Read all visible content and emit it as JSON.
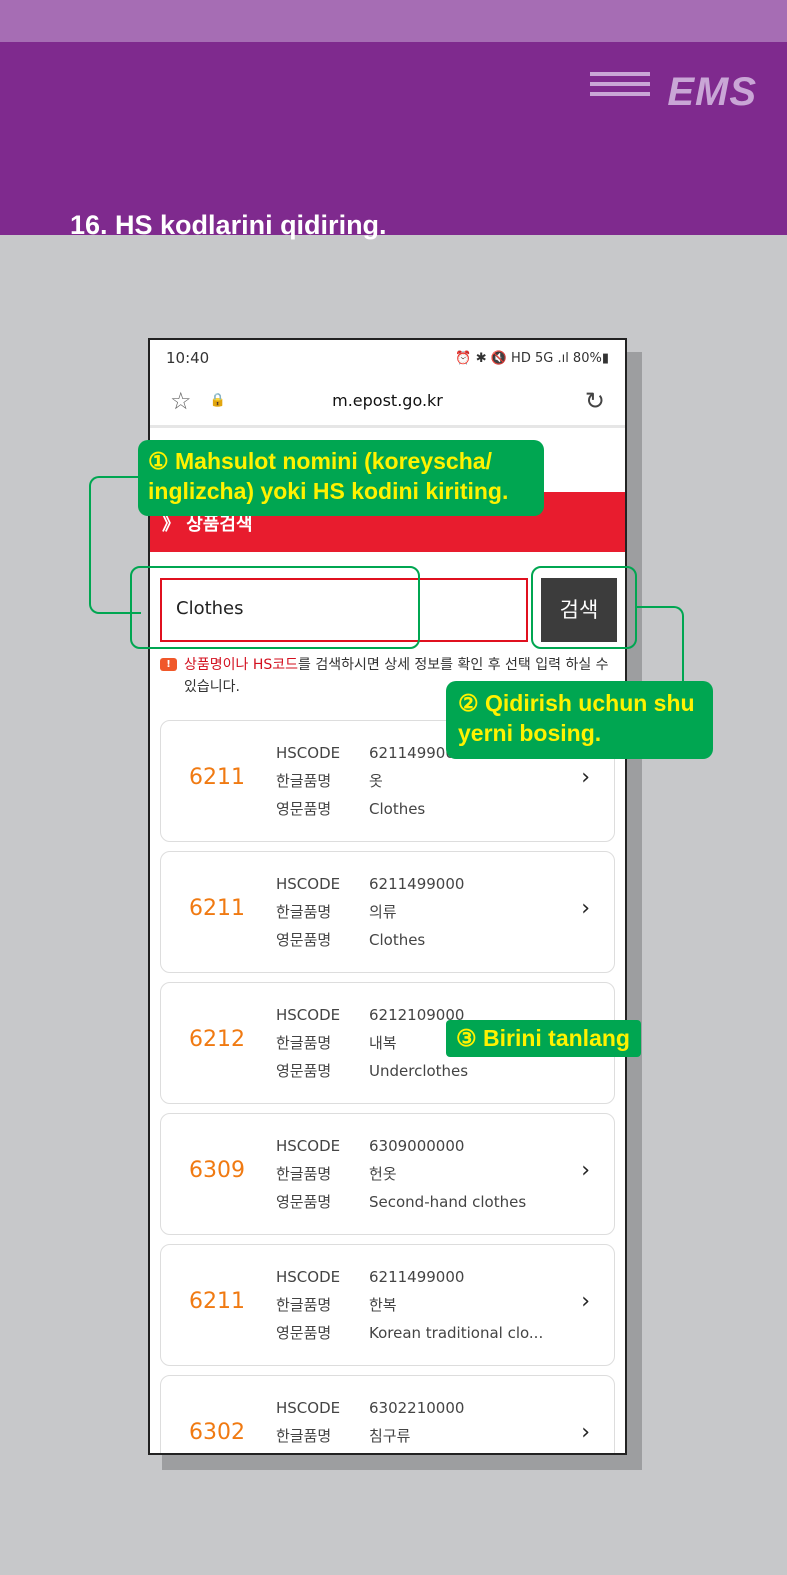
{
  "header": {
    "title": "16. HS kodlarini qidiring.",
    "logo": "EMS"
  },
  "phone": {
    "status": {
      "time": "10:40",
      "right": "⏰ ✱ 🔇 HD 5G .ıl 80%▮"
    },
    "browser": {
      "url": "m.epost.go.kr",
      "favorite_icon": "star-icon",
      "lock_icon": "lock-icon",
      "reload_icon": "reload-icon"
    },
    "section_title": "》 상품검색",
    "search": {
      "value": "Clothes",
      "button": "검색"
    },
    "notice": {
      "highlight": "상품명이나 HS코드",
      "text": "를 검색하시면 상세 정보를 확인 후 선택 입력 하실 수 있습니다."
    },
    "labels": {
      "hscode": "HSCODE",
      "korean": "한글품명",
      "english": "영문품명"
    },
    "results": [
      {
        "code": "6211",
        "hscode": "6211499000",
        "korean": "옷",
        "english": "Clothes"
      },
      {
        "code": "6211",
        "hscode": "6211499000",
        "korean": "의류",
        "english": "Clothes"
      },
      {
        "code": "6212",
        "hscode": "6212109000",
        "korean": "내복",
        "english": "Underclothes"
      },
      {
        "code": "6309",
        "hscode": "6309000000",
        "korean": "헌옷",
        "english": "Second-hand clothes"
      },
      {
        "code": "6211",
        "hscode": "6211499000",
        "korean": "한복",
        "english": "Korean traditional clo..."
      },
      {
        "code": "6302",
        "hscode": "6302210000",
        "korean": "침구류",
        "english": ""
      }
    ]
  },
  "annotations": {
    "a1": "① Mahsulot nomini (koreyscha/ inglizcha) yoki HS kodini kiriting.",
    "a2": "② Qidirish uchun shu yerni bosing.",
    "a3": "③ Birini tanlang"
  },
  "colors": {
    "purple": "#7f2a8e",
    "green": "#00a651",
    "yellow": "#fff200",
    "red": "#e81c2e",
    "orange": "#f07a12"
  }
}
